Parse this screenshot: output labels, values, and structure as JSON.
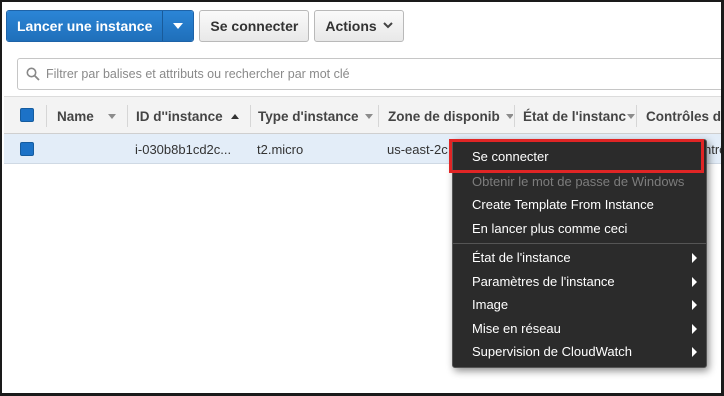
{
  "toolbar": {
    "launch_label": "Lancer une instance",
    "connect_label": "Se connecter",
    "actions_label": "Actions"
  },
  "search": {
    "placeholder": "Filtrer par balises et attributs ou rechercher par mot clé"
  },
  "table": {
    "columns": [
      "Name",
      "ID d''instance",
      "Type d'instance",
      "Zone de disponib",
      "État de l'instanc",
      "Contrôles de"
    ],
    "rows": [
      {
        "name": "",
        "instance_id": "i-030b8b1cd2c...",
        "instance_type": "t2.micro",
        "availability_zone": "us-east-2c",
        "trailing_fragment": "ntrô"
      }
    ]
  },
  "context_menu": {
    "items": [
      {
        "label": "Se connecter",
        "disabled": false,
        "submenu": false
      },
      {
        "label": "Obtenir le mot de passe de Windows",
        "disabled": true,
        "submenu": false
      },
      {
        "label": "Create Template From Instance",
        "disabled": false,
        "submenu": false
      },
      {
        "label": "En lancer plus comme ceci",
        "disabled": false,
        "submenu": false
      },
      {
        "label": "État de l'instance",
        "disabled": false,
        "submenu": true
      },
      {
        "label": "Paramètres de l'instance",
        "disabled": false,
        "submenu": true
      },
      {
        "label": "Image",
        "disabled": false,
        "submenu": true
      },
      {
        "label": "Mise en réseau",
        "disabled": false,
        "submenu": true
      },
      {
        "label": "Supervision de CloudWatch",
        "disabled": false,
        "submenu": true
      }
    ]
  },
  "colors": {
    "primary": "#1f6fba",
    "selected_row": "#e3edf8",
    "menu_bg": "#2b2b2b",
    "highlight": "#e02525"
  },
  "icons": [
    "search-icon",
    "caret-down-icon",
    "chevron-down-icon",
    "sort-icon",
    "submenu-arrow-icon"
  ]
}
